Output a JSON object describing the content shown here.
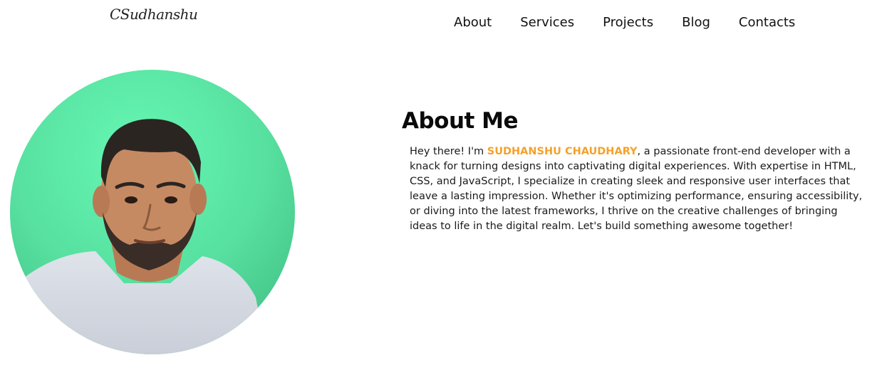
{
  "header": {
    "logo_text": "CSudhanshu",
    "nav": [
      {
        "label": "About"
      },
      {
        "label": "Services"
      },
      {
        "label": "Projects"
      },
      {
        "label": "Blog"
      },
      {
        "label": "Contacts"
      }
    ]
  },
  "about": {
    "title": "About Me",
    "intro_prefix": "Hey there! I'm ",
    "name_highlight": "SUDHANSHU CHAUDHARY",
    "intro_rest": ", a passionate front-end developer with a knack for turning designs into captivating digital experiences. With expertise in HTML, CSS, and JavaScript, I specialize in creating sleek and responsive user interfaces that leave a lasting impression. Whether it's optimizing performance, ensuring accessibility, or diving into the latest frameworks, I thrive on the creative challenges of bringing ideas to life in the digital realm. Let's build something awesome together!"
  },
  "colors": {
    "accent": "#f4a12b",
    "avatar_bg": "#5ce6a4",
    "text": "#111111"
  }
}
